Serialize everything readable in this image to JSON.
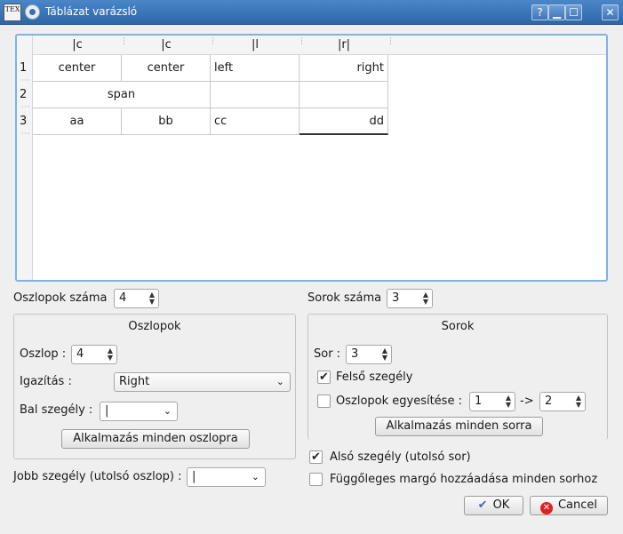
{
  "window": {
    "title": "Táblázat varázsló",
    "app_icon_text": "TEX",
    "help": "?",
    "minimize": "▁",
    "maximize": "☐",
    "close": "✕"
  },
  "table": {
    "column_headers": [
      "|c",
      "|c",
      "|l",
      "|r|"
    ],
    "row_numbers": [
      "1",
      "2",
      "3"
    ],
    "rows": [
      [
        "center",
        "center",
        "left",
        "right"
      ],
      [
        "span",
        "",
        ""
      ],
      [
        "aa",
        "bb",
        "cc",
        "dd"
      ]
    ]
  },
  "columns": {
    "count_label": "Oszlopok száma",
    "count_value": "4",
    "group_title": "Oszlopok",
    "column_label": "Oszlop :",
    "column_value": "4",
    "align_label": "Igazítás :",
    "align_value": "Right",
    "left_border_label": "Bal szegély :",
    "left_border_value": "|",
    "apply_all_label": "Alkalmazás minden oszlopra",
    "right_border_label": "Jobb szegély (utolsó oszlop) :",
    "right_border_value": "|"
  },
  "rows": {
    "count_label": "Sorok száma",
    "count_value": "3",
    "group_title": "Sorok",
    "row_label": "Sor :",
    "row_value": "3",
    "top_border_label": "Felső szegély",
    "top_border_checked": true,
    "merge_label": "Oszlopok egyesítése :",
    "merge_checked": false,
    "merge_from": "1",
    "merge_arrow": "->",
    "merge_to": "2",
    "apply_all_label": "Alkalmazás minden sorra",
    "bottom_border_label": "Alsó szegély (utolsó sor)",
    "bottom_border_checked": true,
    "vmargin_label": "Függőleges margó hozzáadása minden sorhoz",
    "vmargin_checked": false
  },
  "buttons": {
    "ok": "OK",
    "cancel": "Cancel"
  }
}
